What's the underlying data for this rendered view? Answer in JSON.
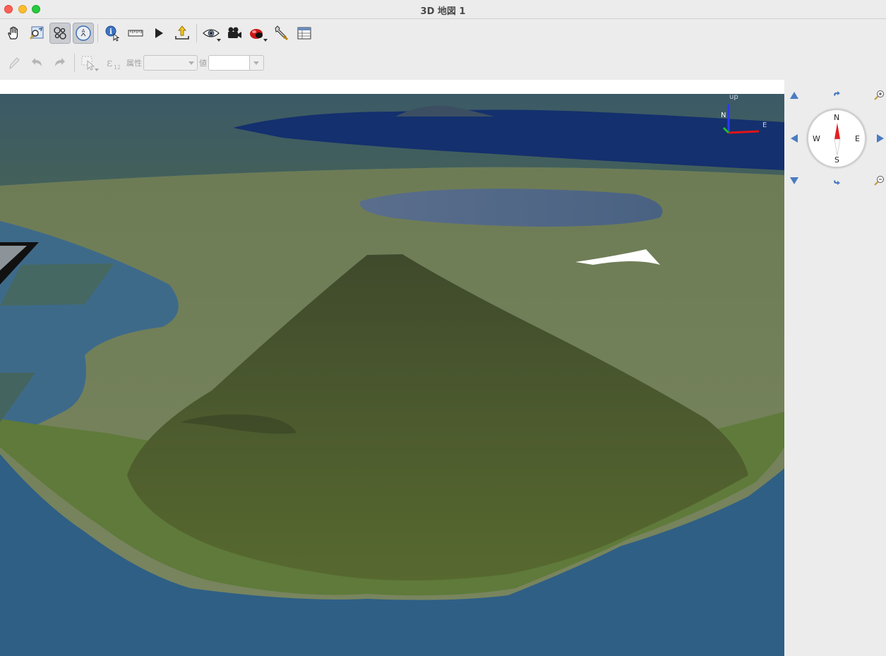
{
  "window": {
    "title": "3D 地図 1"
  },
  "toolbar_main": {
    "pan_label": "Pan",
    "zoom_full_label": "Zoom Full",
    "toggle_terrain_label": "Toggle On-Screen Navigation",
    "camera_nav_label": "Camera Navigation",
    "identify_label": "Identify",
    "measure_label": "Measure Line",
    "animation_label": "Animations",
    "save_image_label": "Export",
    "view_label": "Camera",
    "effects_label": "Effects",
    "options_label": "Configure",
    "table_label": "Table"
  },
  "toolbar_edit": {
    "attribute_label": "属性",
    "attribute_value": "",
    "value_label": "値",
    "value_text": ""
  },
  "navigation": {
    "north": "N",
    "south": "S",
    "east": "E",
    "west": "W"
  },
  "axis_gizmo": {
    "up_label": "up",
    "north_label": "N",
    "east_label": "E"
  },
  "colors": {
    "sea_deep": "#1a3a8a",
    "ocean": "#3d6f94",
    "land_green": "#5a6e36",
    "compass_red": "#e02020"
  }
}
